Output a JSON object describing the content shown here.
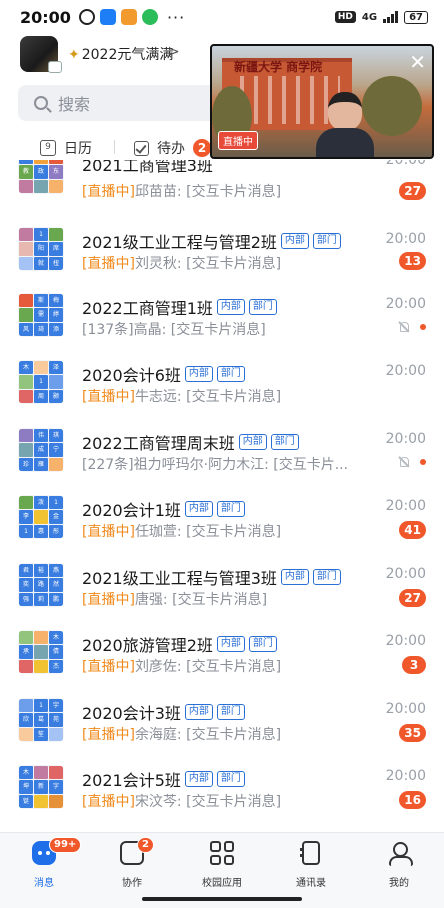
{
  "status_bar": {
    "time": "20:00",
    "hd": "HD",
    "network": "4G",
    "battery": "67",
    "overflow": "···"
  },
  "header": {
    "user_name": "2022元气满满",
    "user_chevron": ">",
    "search_placeholder": "搜索",
    "calendar_label": "日历",
    "calendar_day": "9",
    "todo_label": "待办",
    "todo_count": "2"
  },
  "live_window": {
    "sign_text": "新疆大学 商学院",
    "badge": "直播中",
    "close": "✕"
  },
  "chats": [
    {
      "title": "2021工商管理3班",
      "tags": [],
      "time": "20:00",
      "live": "[直播中]",
      "preview": "邱苗苗: [交互卡片消息]",
      "count": "27",
      "muted": false
    },
    {
      "title": "2021级工业工程与管理2班",
      "tags": [
        "内部",
        "部门"
      ],
      "time": "20:00",
      "live": "[直播中]",
      "preview": "刘灵秋: [交互卡片消息]",
      "count": "13",
      "muted": false
    },
    {
      "title": "2022工商管理1班",
      "tags": [
        "内部",
        "部门"
      ],
      "time": "20:00",
      "live": "",
      "preview": "[137条]高晶: [交互卡片消息]",
      "count": "",
      "muted": true
    },
    {
      "title": "2020会计6班",
      "tags": [
        "内部",
        "部门"
      ],
      "time": "20:00",
      "live": "[直播中]",
      "preview": "牛志远: [交互卡片消息]",
      "count": "",
      "muted": false
    },
    {
      "title": "2022工商管理周末班",
      "tags": [
        "内部",
        "部门"
      ],
      "time": "20:00",
      "live": "",
      "preview": "[227条]祖力呼玛尔·阿力木江: [交互卡片...",
      "count": "",
      "muted": true
    },
    {
      "title": "2020会计1班",
      "tags": [
        "内部",
        "部门"
      ],
      "time": "20:00",
      "live": "[直播中]",
      "preview": "任珈萱: [交互卡片消息]",
      "count": "41",
      "muted": false
    },
    {
      "title": "2021级工业工程与管理3班",
      "tags": [
        "内部",
        "部门"
      ],
      "time": "20:00",
      "live": "[直播中]",
      "preview": "唐强: [交互卡片消息]",
      "count": "27",
      "muted": false
    },
    {
      "title": "2020旅游管理2班",
      "tags": [
        "内部",
        "部门"
      ],
      "time": "20:00",
      "live": "[直播中]",
      "preview": "刘彦佐: [交互卡片消息]",
      "count": "3",
      "muted": false
    },
    {
      "title": "2020会计3班",
      "tags": [
        "内部",
        "部门"
      ],
      "time": "20:00",
      "live": "[直播中]",
      "preview": "余海庭: [交互卡片消息]",
      "count": "35",
      "muted": false
    },
    {
      "title": "2021会计5班",
      "tags": [
        "内部",
        "部门"
      ],
      "time": "20:00",
      "live": "[直播中]",
      "preview": "宋汶芩: [交互卡片消息]",
      "count": "16",
      "muted": false
    }
  ],
  "bottom_nav": {
    "items": [
      {
        "label": "消息",
        "badge": "99+",
        "icon": "message-icon"
      },
      {
        "label": "协作",
        "badge": "2",
        "icon": "collab-icon"
      },
      {
        "label": "校园应用",
        "badge": "",
        "icon": "apps-grid-icon"
      },
      {
        "label": "通讯录",
        "badge": "",
        "icon": "contacts-icon"
      },
      {
        "label": "我的",
        "badge": "",
        "icon": "profile-icon"
      }
    ]
  },
  "colors": {
    "accent": "#1e6fe8",
    "badge": "#f0582b",
    "live": "#f08a1c",
    "tag": "#2a6fd6"
  }
}
